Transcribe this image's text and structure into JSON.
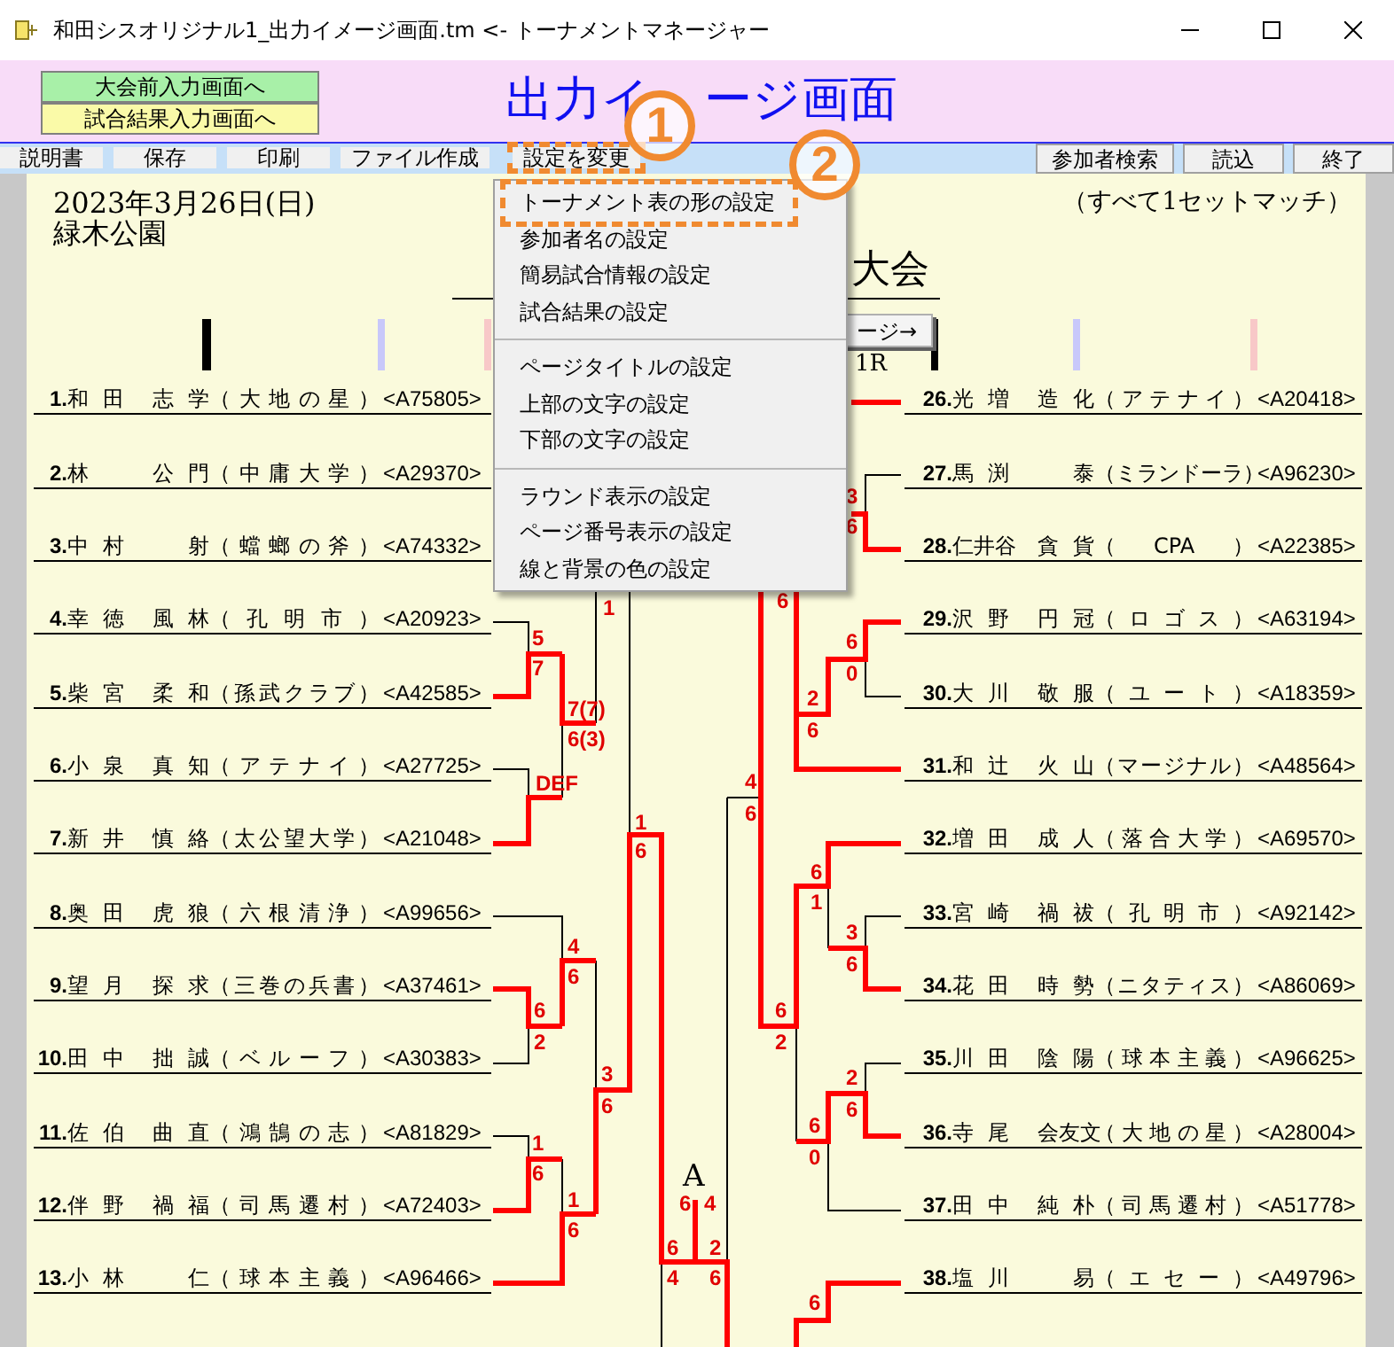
{
  "window": {
    "title": "和田シスオリジナル1_出力イメージ画面.tm <- トーナメントマネージャー"
  },
  "nav_buttons": [
    {
      "label": "大会前入力画面へ",
      "kind": "green"
    },
    {
      "label": "試合結果入力画面へ",
      "kind": "yellow"
    }
  ],
  "screen_title_parts": [
    "出力イ",
    "ージ画面"
  ],
  "toolbar_left": [
    {
      "label": "説明書",
      "highlighted": false
    },
    {
      "label": "保存",
      "highlighted": false
    },
    {
      "label": "印刷",
      "highlighted": false
    },
    {
      "label": "ファイル作成",
      "highlighted": false
    },
    {
      "label": "設定を変更",
      "highlighted": true
    }
  ],
  "toolbar_right": [
    "参加者検索",
    "読込",
    "終了"
  ],
  "date": "2023年3月26日(日)",
  "venue": "緑木公園",
  "match_format": "（すべて1セットマッチ）",
  "tournament_title": "大会",
  "page_button": "ージ→",
  "round_label": "1R",
  "left_entries": [
    {
      "no": "1.",
      "family": "和田",
      "given": "志学",
      "team": "（大地の星）",
      "code": "<A75805>"
    },
    {
      "no": "2.",
      "family": "林",
      "given": "公門",
      "team": "（中庸大学）",
      "code": "<A29370>"
    },
    {
      "no": "3.",
      "family": "中村",
      "given": "射",
      "team": "（蟷螂の斧）",
      "code": "<A74332>"
    },
    {
      "no": "4.",
      "family": "幸徳",
      "given": "風林",
      "team": "（孔明市）",
      "code": "<A20923>"
    },
    {
      "no": "5.",
      "family": "柴宮",
      "given": "柔和",
      "team": "（孫武クラブ）",
      "code": "<A42585>"
    },
    {
      "no": "6.",
      "family": "小泉",
      "given": "真知",
      "team": "（アテナイ）",
      "code": "<A27725>"
    },
    {
      "no": "7.",
      "family": "新井",
      "given": "慎絡",
      "team": "（太公望大学）",
      "code": "<A21048>"
    },
    {
      "no": "8.",
      "family": "奥田",
      "given": "虎狼",
      "team": "（六根清浄）",
      "code": "<A99656>"
    },
    {
      "no": "9.",
      "family": "望月",
      "given": "探求",
      "team": "（三巻の兵書）",
      "code": "<A37461>"
    },
    {
      "no": "10.",
      "family": "田中",
      "given": "拙誠",
      "team": "（ベルーフ）",
      "code": "<A30383>"
    },
    {
      "no": "11.",
      "family": "佐伯",
      "given": "曲直",
      "team": "（鴻鵠の志）",
      "code": "<A81829>"
    },
    {
      "no": "12.",
      "family": "伴野",
      "given": "禍福",
      "team": "（司馬遷村）",
      "code": "<A72403>"
    },
    {
      "no": "13.",
      "family": "小林",
      "given": "仁",
      "team": "（球本主義）",
      "code": "<A96466>"
    }
  ],
  "right_entries": [
    {
      "no": "26.",
      "family": "光増",
      "given": "造化",
      "team": "（アテナイ）",
      "code": "<A20418>"
    },
    {
      "no": "27.",
      "family": "馬渕",
      "given": "泰",
      "team": "（ミランドーラ）",
      "code": "<A96230>"
    },
    {
      "no": "28.",
      "family": "仁井谷",
      "given": "貪貨",
      "team": "（CPA）",
      "code": "<A22385>"
    },
    {
      "no": "29.",
      "family": "沢野",
      "given": "円冠",
      "team": "（ロゴス）",
      "code": "<A63194>"
    },
    {
      "no": "30.",
      "family": "大川",
      "given": "敬服",
      "team": "（ユート）",
      "code": "<A18359>"
    },
    {
      "no": "31.",
      "family": "和辻",
      "given": "火山",
      "team": "（マージナル）",
      "code": "<A48564>"
    },
    {
      "no": "32.",
      "family": "増田",
      "given": "成人",
      "team": "（落合大学）",
      "code": "<A69570>"
    },
    {
      "no": "33.",
      "family": "宮崎",
      "given": "禍祓",
      "team": "（孔明市）",
      "code": "<A92142>"
    },
    {
      "no": "34.",
      "family": "花田",
      "given": "時勢",
      "team": "（ニタティス）",
      "code": "<A86069>"
    },
    {
      "no": "35.",
      "family": "川田",
      "given": "陰陽",
      "team": "（球本主義）",
      "code": "<A96625>"
    },
    {
      "no": "36.",
      "family": "寺尾",
      "given": "会友文",
      "team": "（大地の星）",
      "code": "<A28004>"
    },
    {
      "no": "37.",
      "family": "田中",
      "given": "純朴",
      "team": "（司馬遷村）",
      "code": "<A51778>"
    },
    {
      "no": "38.",
      "family": "塩川",
      "given": "易",
      "team": "（エセー）",
      "code": "<A49796>"
    }
  ],
  "scores": [
    "1",
    "5",
    "7",
    "7(7)",
    "6(3)",
    "DEF",
    "1",
    "6",
    "4",
    "6",
    "6",
    "2",
    "3",
    "6",
    "1",
    "6",
    "1",
    "6",
    "6",
    "4",
    "6",
    "4",
    "2",
    "6",
    "3",
    "6",
    "6",
    "6",
    "0",
    "2",
    "6",
    "4",
    "6",
    "6",
    "1",
    "3",
    "6",
    "6",
    "2",
    "2",
    "6",
    "6",
    "0",
    "6"
  ],
  "final_label": "A",
  "menu": [
    [
      {
        "label": "トーナメント表の形の設定",
        "highlighted": true
      },
      {
        "label": "参加者名の設定",
        "highlighted": false
      },
      {
        "label": "簡易試合情報の設定",
        "highlighted": false
      },
      {
        "label": "試合結果の設定",
        "highlighted": false
      }
    ],
    [
      {
        "label": "ページタイトルの設定",
        "highlighted": false
      },
      {
        "label": "上部の文字の設定",
        "highlighted": false
      },
      {
        "label": "下部の文字の設定",
        "highlighted": false
      }
    ],
    [
      {
        "label": "ラウンド表示の設定",
        "highlighted": false
      },
      {
        "label": "ページ番号表示の設定",
        "highlighted": false
      },
      {
        "label": "線と背景の色の設定",
        "highlighted": false
      }
    ]
  ],
  "callouts": [
    "1",
    "2"
  ]
}
